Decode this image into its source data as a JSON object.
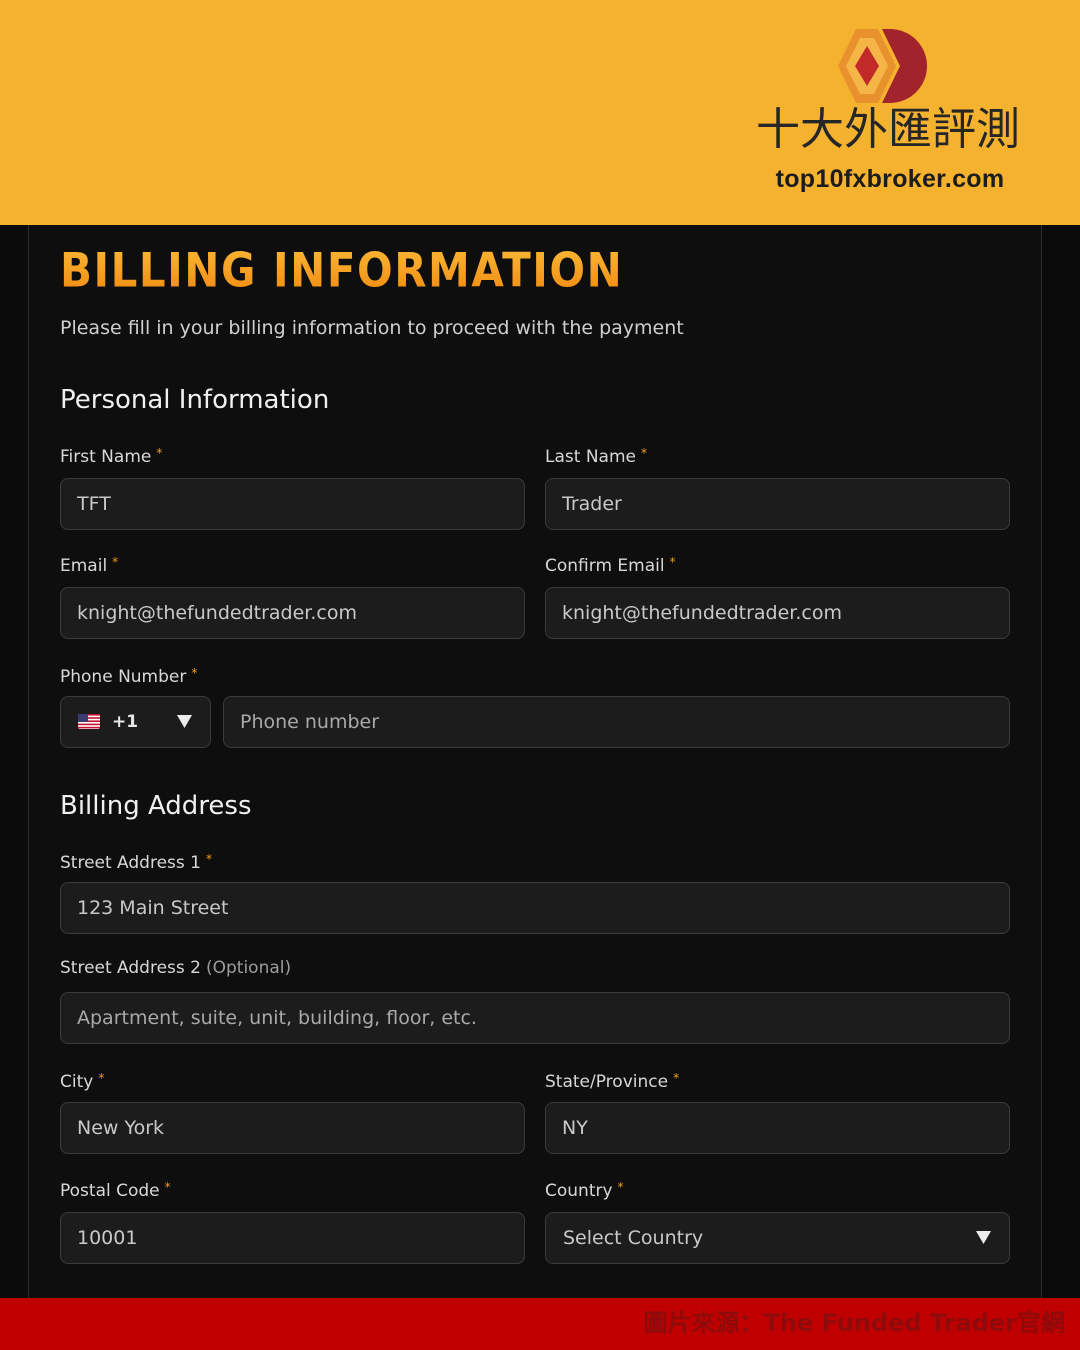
{
  "colors": {
    "banner": "#F4B22F",
    "accent": "#F59E1B",
    "footer_band": "#C00000",
    "background": "#0B0B0B"
  },
  "brand": {
    "logo_icon": "brand-diamond-logo-icon",
    "name": "十大外匯評測",
    "domain": "top10fxbroker.com"
  },
  "form": {
    "title": "BILLING INFORMATION",
    "subtitle": "Please fill in your billing information to proceed with the payment",
    "required_mark": "*",
    "personal": {
      "heading": "Personal Information",
      "first_name": {
        "label": "First Name",
        "value": "TFT"
      },
      "last_name": {
        "label": "Last Name",
        "value": "Trader"
      },
      "email": {
        "label": "Email",
        "value": "knight@thefundedtrader.com"
      },
      "confirm_email": {
        "label": "Confirm Email",
        "value": "knight@thefundedtrader.com"
      },
      "phone": {
        "label": "Phone Number",
        "country_flag_icon": "us-flag-icon",
        "dial_code": "+1",
        "dropdown_icon": "caret-down-icon",
        "placeholder": "Phone number"
      }
    },
    "billing": {
      "heading": "Billing Address",
      "street_address_1": {
        "label": "Street Address 1",
        "value": "123 Main Street"
      },
      "street_address_2": {
        "label": "Street Address 2",
        "note": "(Optional)",
        "placeholder": "Apartment, suite, unit, building, floor, etc."
      },
      "city": {
        "label": "City",
        "value": "New York"
      },
      "state_province": {
        "label": "State/Province",
        "value": "NY"
      },
      "postal_code": {
        "label": "Postal Code",
        "value": "10001"
      },
      "country": {
        "label": "Country",
        "selected": "Select Country",
        "dropdown_icon": "caret-down-icon"
      }
    }
  },
  "footer": {
    "image_credit": "圖片來源：The Funded Trader官網"
  }
}
